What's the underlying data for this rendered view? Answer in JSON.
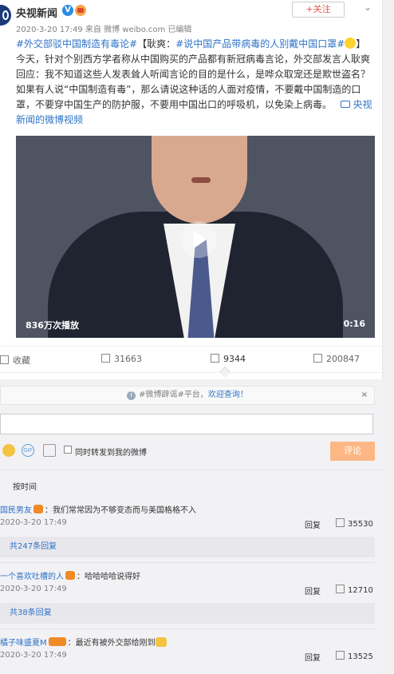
{
  "post": {
    "author": "央视新闻",
    "verified": "V",
    "follow_label": "+关注",
    "meta": "2020-3-20 17:49  来自 微博 weibo.com   已编辑",
    "hashtag1": "#外交部驳中国制造有毒论#",
    "bracket_open": "【",
    "name_lead": "耿爽：",
    "hashtag2": "#说中国产品带病毒的人别戴中国口罩#",
    "bracket_close": "】",
    "body": "今天，针对个别西方学者称从中国购买的产品都有新冠病毒言论，外交部发言人耿爽回应：我不知道这些人发表耸人听闻言论的目的是什么，是哗众取宠还是欺世盗名？如果有人说“中国制造有毒”，那么请说这种话的人面对疫情，不要戴中国制造的口罩，不要穿中国生产的防护服，不要用中国出口的呼吸机，以免染上病毒。",
    "video_link": "央视新闻的微博视频",
    "video_plays": "836万次播放",
    "video_duration": "0:16"
  },
  "actions": {
    "favorite": "收藏",
    "repost": "31663",
    "comment": "9344",
    "like": "200847"
  },
  "comment_box": {
    "notice_prefix": "#微博辟谣#平台，",
    "notice_link": "欢迎查询！",
    "notice_close": "×",
    "input_value": "",
    "gif_label": "GIF",
    "also_repost": "同时转发到我的微博",
    "submit": "评论",
    "sort_label": "按时间"
  },
  "comments": [
    {
      "user": "国民男友",
      "text": "：我们常常因为不够变态而与美国格格不入",
      "date": "2020-3-20 17:49",
      "reply": "回复",
      "likes": "35530",
      "more": "共247条回复"
    },
    {
      "user": "一个喜欢吐槽的人",
      "text": "：哈哈哈哈说得好",
      "date": "2020-3-20 17:49",
      "reply": "回复",
      "likes": "12710",
      "more": "共38条回复"
    },
    {
      "user": "橘子味盛夏M",
      "text": "：最近有被外交部给刚到",
      "date": "2020-3-20 17:49",
      "reply": "回复",
      "likes": "13525",
      "more": ""
    }
  ],
  "colors": {
    "link": "#2f72c7",
    "submit_bg": "#fdb784",
    "follow": "#e5584a"
  },
  "icons": [
    "avatar-icon",
    "verified-icon",
    "chevron-down-icon",
    "video-icon",
    "play-icon",
    "favorite-icon",
    "repost-icon",
    "comment-icon",
    "like-icon",
    "info-icon",
    "emoji-icon",
    "gif-icon",
    "image-icon"
  ]
}
